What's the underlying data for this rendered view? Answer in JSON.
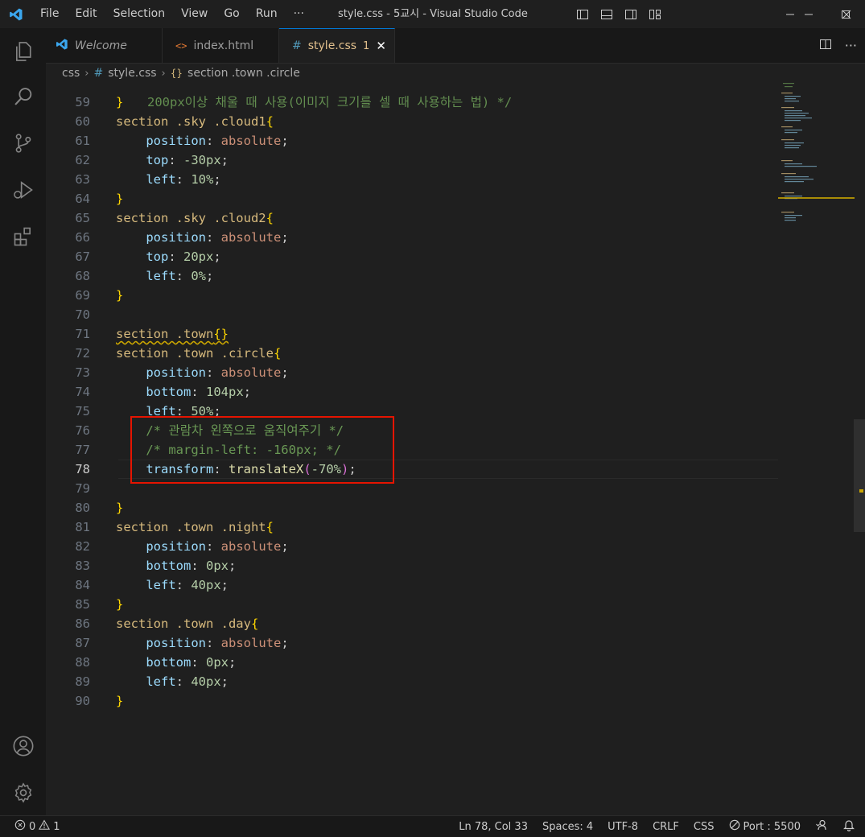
{
  "window": {
    "title": "style.css - 5교시 - Visual Studio Code"
  },
  "menu": [
    "File",
    "Edit",
    "Selection",
    "View",
    "Go",
    "Run",
    "···"
  ],
  "tabs": [
    {
      "label": "Welcome",
      "icon": "vscode-logo-icon",
      "active": false
    },
    {
      "label": "index.html",
      "icon": "html-file-icon",
      "active": false
    },
    {
      "label": "style.css",
      "icon": "css-file-icon",
      "active": true,
      "problems": "1"
    }
  ],
  "breadcrumb": {
    "folder": "css",
    "file": "style.css",
    "symbol": "section .town .circle"
  },
  "editor": {
    "partial_top_line": "200px이상 채울 때 사용(이미지 크기를 셀 때 사용하는 법) */",
    "current_line": "78",
    "lines": [
      {
        "n": "59",
        "t": [
          [
            "}",
            "brk"
          ]
        ]
      },
      {
        "n": "60",
        "t": [
          [
            "section .sky .cloud1",
            "sel"
          ],
          [
            "{",
            "brk"
          ]
        ]
      },
      {
        "n": "61",
        "t": [
          [
            "    ",
            "pun"
          ],
          [
            "position",
            "prop"
          ],
          [
            ": ",
            "pun"
          ],
          [
            "absolute",
            "val"
          ],
          [
            ";",
            "pun"
          ]
        ]
      },
      {
        "n": "62",
        "t": [
          [
            "    ",
            "pun"
          ],
          [
            "top",
            "prop"
          ],
          [
            ": ",
            "pun"
          ],
          [
            "-30px",
            "num"
          ],
          [
            ";",
            "pun"
          ]
        ]
      },
      {
        "n": "63",
        "t": [
          [
            "    ",
            "pun"
          ],
          [
            "left",
            "prop"
          ],
          [
            ": ",
            "pun"
          ],
          [
            "10%",
            "num"
          ],
          [
            ";",
            "pun"
          ]
        ]
      },
      {
        "n": "64",
        "t": [
          [
            "}",
            "brk"
          ]
        ]
      },
      {
        "n": "65",
        "t": [
          [
            "section .sky .cloud2",
            "sel"
          ],
          [
            "{",
            "brk"
          ]
        ]
      },
      {
        "n": "66",
        "t": [
          [
            "    ",
            "pun"
          ],
          [
            "position",
            "prop"
          ],
          [
            ": ",
            "pun"
          ],
          [
            "absolute",
            "val"
          ],
          [
            ";",
            "pun"
          ]
        ]
      },
      {
        "n": "67",
        "t": [
          [
            "    ",
            "pun"
          ],
          [
            "top",
            "prop"
          ],
          [
            ": ",
            "pun"
          ],
          [
            "20px",
            "num"
          ],
          [
            ";",
            "pun"
          ]
        ]
      },
      {
        "n": "68",
        "t": [
          [
            "    ",
            "pun"
          ],
          [
            "left",
            "prop"
          ],
          [
            ": ",
            "pun"
          ],
          [
            "0%",
            "num"
          ],
          [
            ";",
            "pun"
          ]
        ]
      },
      {
        "n": "69",
        "t": [
          [
            "}",
            "brk"
          ]
        ]
      },
      {
        "n": "70",
        "t": []
      },
      {
        "n": "71",
        "t": [
          [
            "section .town",
            "sel squig"
          ],
          [
            "{}",
            "brk squig"
          ]
        ]
      },
      {
        "n": "72",
        "t": [
          [
            "section .town .circle",
            "sel"
          ],
          [
            "{",
            "brk"
          ]
        ]
      },
      {
        "n": "73",
        "t": [
          [
            "    ",
            "pun"
          ],
          [
            "position",
            "prop"
          ],
          [
            ": ",
            "pun"
          ],
          [
            "absolute",
            "val"
          ],
          [
            ";",
            "pun"
          ]
        ]
      },
      {
        "n": "74",
        "t": [
          [
            "    ",
            "pun"
          ],
          [
            "bottom",
            "prop"
          ],
          [
            ": ",
            "pun"
          ],
          [
            "104px",
            "num"
          ],
          [
            ";",
            "pun"
          ]
        ]
      },
      {
        "n": "75",
        "t": [
          [
            "    ",
            "pun"
          ],
          [
            "left",
            "prop"
          ],
          [
            ": ",
            "pun"
          ],
          [
            "50%",
            "num"
          ],
          [
            ";",
            "pun"
          ]
        ]
      },
      {
        "n": "76",
        "t": [
          [
            "    ",
            "pun"
          ],
          [
            "/* 관람차 왼쪽으로 움직여주기 */",
            "cmt"
          ]
        ]
      },
      {
        "n": "77",
        "t": [
          [
            "    ",
            "pun"
          ],
          [
            "/* margin-left: -160px; */",
            "cmt"
          ]
        ]
      },
      {
        "n": "78",
        "t": [
          [
            "    ",
            "pun"
          ],
          [
            "transform",
            "prop"
          ],
          [
            ": ",
            "pun"
          ],
          [
            "translateX",
            "fn"
          ],
          [
            "(",
            "pbr"
          ],
          [
            "-70%",
            "num"
          ],
          [
            ")",
            "pbr"
          ],
          [
            ";",
            "pun"
          ]
        ]
      },
      {
        "n": "79",
        "t": []
      },
      {
        "n": "80",
        "t": [
          [
            "}",
            "brk"
          ]
        ]
      },
      {
        "n": "81",
        "t": [
          [
            "section .town .night",
            "sel"
          ],
          [
            "{",
            "brk"
          ]
        ]
      },
      {
        "n": "82",
        "t": [
          [
            "    ",
            "pun"
          ],
          [
            "position",
            "prop"
          ],
          [
            ": ",
            "pun"
          ],
          [
            "absolute",
            "val"
          ],
          [
            ";",
            "pun"
          ]
        ]
      },
      {
        "n": "83",
        "t": [
          [
            "    ",
            "pun"
          ],
          [
            "bottom",
            "prop"
          ],
          [
            ": ",
            "pun"
          ],
          [
            "0px",
            "num"
          ],
          [
            ";",
            "pun"
          ]
        ]
      },
      {
        "n": "84",
        "t": [
          [
            "    ",
            "pun"
          ],
          [
            "left",
            "prop"
          ],
          [
            ": ",
            "pun"
          ],
          [
            "40px",
            "num"
          ],
          [
            ";",
            "pun"
          ]
        ]
      },
      {
        "n": "85",
        "t": [
          [
            "}",
            "brk"
          ]
        ]
      },
      {
        "n": "86",
        "t": [
          [
            "section .town .day",
            "sel"
          ],
          [
            "{",
            "brk"
          ]
        ]
      },
      {
        "n": "87",
        "t": [
          [
            "    ",
            "pun"
          ],
          [
            "position",
            "prop"
          ],
          [
            ": ",
            "pun"
          ],
          [
            "absolute",
            "val"
          ],
          [
            ";",
            "pun"
          ]
        ]
      },
      {
        "n": "88",
        "t": [
          [
            "    ",
            "pun"
          ],
          [
            "bottom",
            "prop"
          ],
          [
            ": ",
            "pun"
          ],
          [
            "0px",
            "num"
          ],
          [
            ";",
            "pun"
          ]
        ]
      },
      {
        "n": "89",
        "t": [
          [
            "    ",
            "pun"
          ],
          [
            "left",
            "prop"
          ],
          [
            ": ",
            "pun"
          ],
          [
            "40px",
            "num"
          ],
          [
            ";",
            "pun"
          ]
        ]
      },
      {
        "n": "90",
        "t": [
          [
            "}",
            "brk"
          ]
        ]
      }
    ]
  },
  "statusbar": {
    "errors": "0",
    "warnings": "1",
    "cursor": "Ln 78, Col 33",
    "spaces": "Spaces: 4",
    "encoding": "UTF-8",
    "eol": "CRLF",
    "language": "CSS",
    "port": "Port : 5500"
  },
  "colors": {
    "accent": "#0078d4",
    "highlight_box": "#e51400",
    "tab_modified": "#e2c08d"
  }
}
